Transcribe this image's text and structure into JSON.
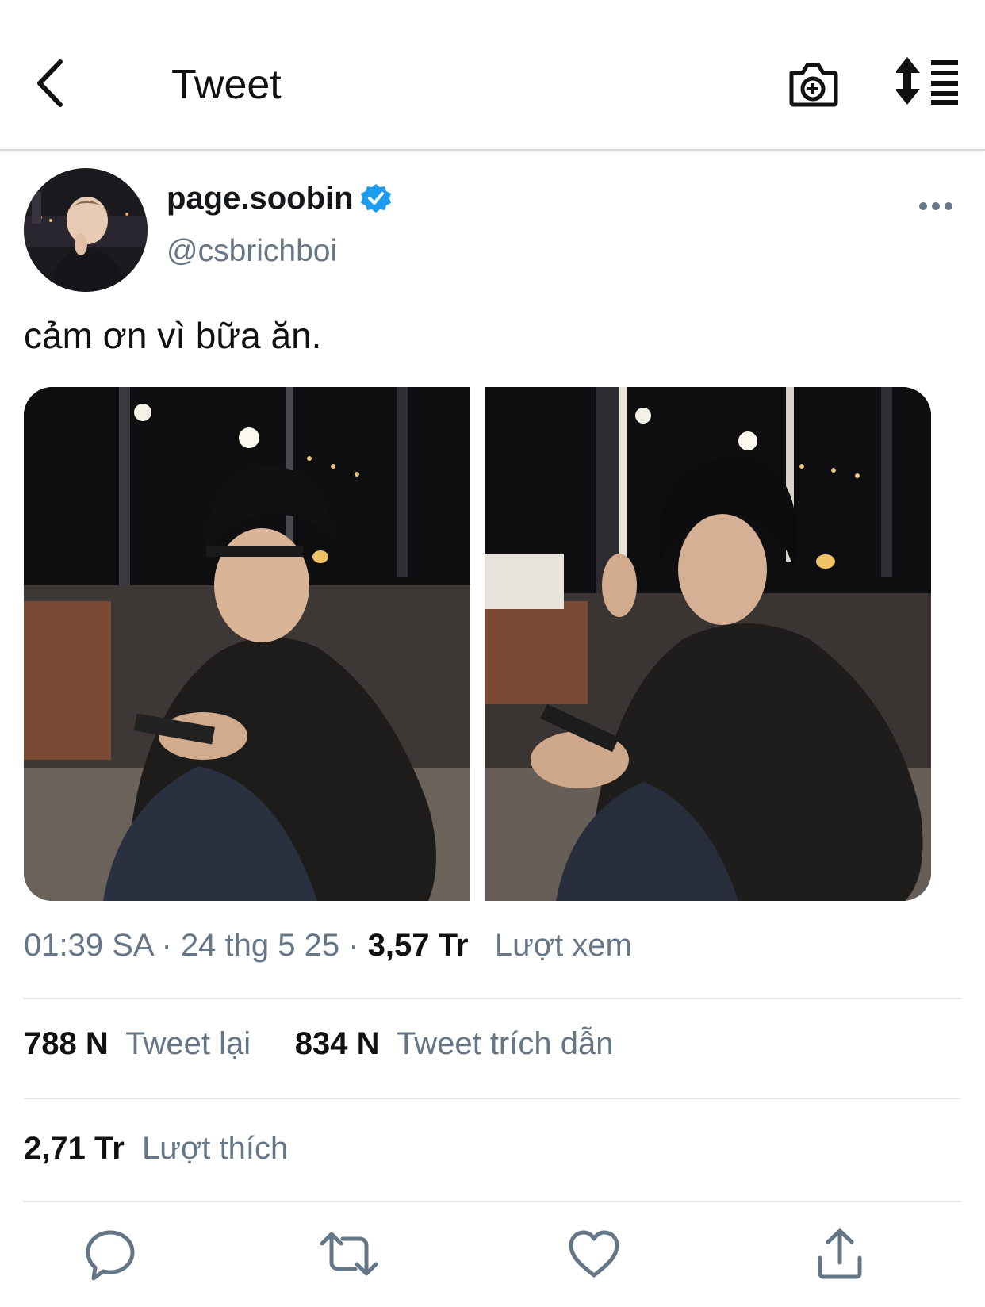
{
  "header": {
    "title": "Tweet"
  },
  "author": {
    "display_name": "page.soobin",
    "handle": "@csbrichboi",
    "verified": true
  },
  "tweet": {
    "text": "cảm ơn vì bữa ăn.",
    "time": "01:39 SA",
    "date": "24 thg 5 25",
    "views_count": "3,57 Tr",
    "views_label": "Lượt xem"
  },
  "stats": {
    "retweets_count": "788 N",
    "retweets_label": "Tweet lại",
    "quotes_count": "834 N",
    "quotes_label": "Tweet trích dẫn",
    "likes_count": "2,71 Tr",
    "likes_label": "Lượt thích"
  },
  "colors": {
    "verified_blue": "#1d9bf0",
    "secondary_text": "#657786",
    "divider": "#e3e3e3"
  },
  "icons": [
    "back-icon",
    "camera-add-icon",
    "sort-icon",
    "verified-icon",
    "more-icon",
    "reply-icon",
    "retweet-icon",
    "like-icon",
    "share-icon"
  ]
}
